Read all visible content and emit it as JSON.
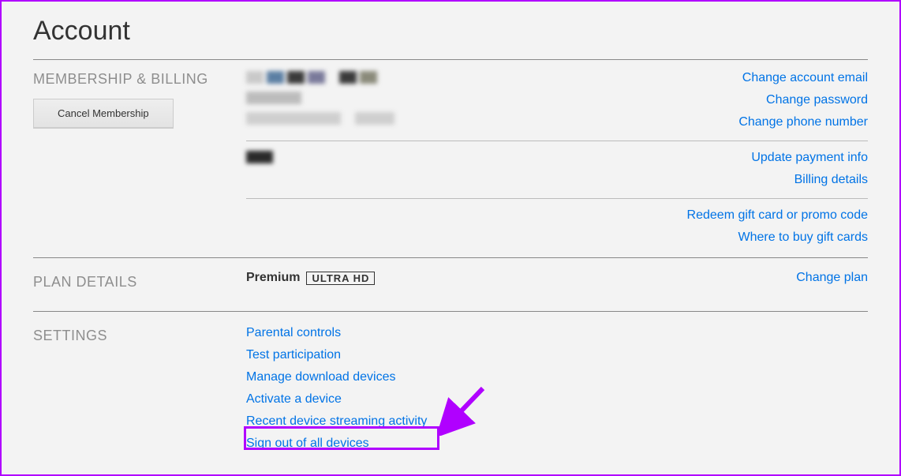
{
  "page": {
    "title": "Account"
  },
  "membership": {
    "label": "MEMBERSHIP & BILLING",
    "cancel_button": "Cancel Membership",
    "links": {
      "change_email": "Change account email",
      "change_password": "Change password",
      "change_phone": "Change phone number",
      "update_payment": "Update payment info",
      "billing_details": "Billing details",
      "redeem": "Redeem gift card or promo code",
      "where_buy": "Where to buy gift cards"
    }
  },
  "plan": {
    "label": "PLAN DETAILS",
    "name": "Premium",
    "badge_ultra": "ULTRA",
    "badge_hd": "HD",
    "change_link": "Change plan"
  },
  "settings": {
    "label": "SETTINGS",
    "links": {
      "parental": "Parental controls",
      "test": "Test participation",
      "manage_downloads": "Manage download devices",
      "activate": "Activate a device",
      "recent_activity": "Recent device streaming activity",
      "sign_out": "Sign out of all devices"
    }
  }
}
